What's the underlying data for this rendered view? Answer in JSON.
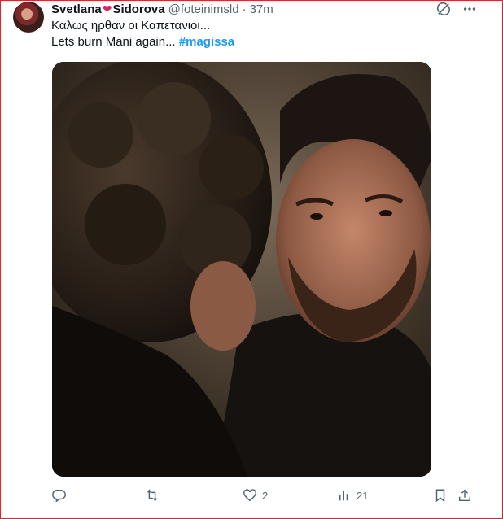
{
  "tweet": {
    "display_name_first": "Svetlana",
    "display_name_second": "Sidorova",
    "name_emoji": "❤",
    "handle": "@foteinimsld",
    "separator": "·",
    "timestamp": "37m",
    "text_line1": "Καλως ηρθαν οι Καπετανιοι...",
    "text_line2": "Lets burn Mani again...",
    "hashtag": "#magissa"
  },
  "actions": {
    "reply_count": "",
    "retweet_count": "",
    "like_count": "2",
    "views_count": "21"
  },
  "icons": {
    "top": [
      "grok-icon",
      "more-icon"
    ],
    "actions": [
      "reply-icon",
      "retweet-icon",
      "like-icon",
      "views-icon",
      "bookmark-icon",
      "share-icon"
    ]
  },
  "colors": {
    "accent": "#1d9bf0",
    "heart": "#e0245e",
    "muted": "#536471",
    "border": "#e0262b"
  }
}
